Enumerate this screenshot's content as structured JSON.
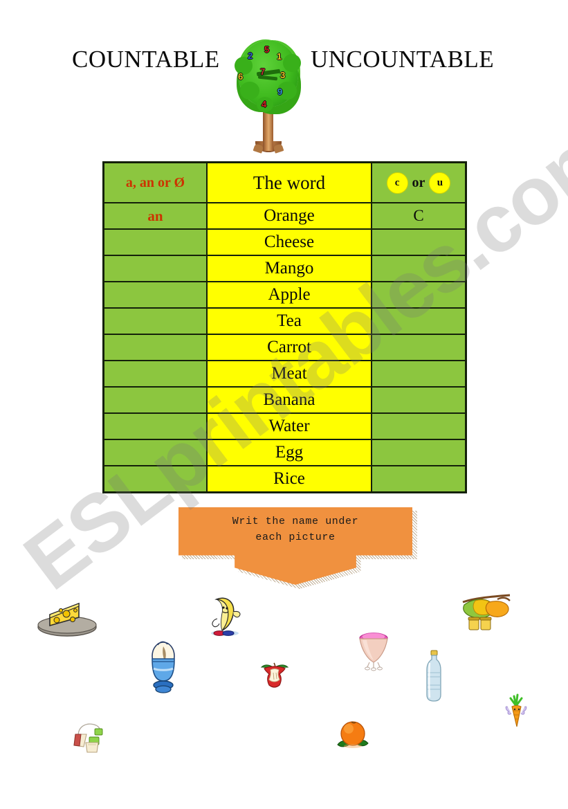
{
  "document": {
    "title_left": "COUNTABLE",
    "title_right": "UNCOUNTABLE",
    "watermark": "ESLprintables.com"
  },
  "tree": {
    "name": "number-tree",
    "numbers": [
      "2",
      "5",
      "1",
      "7",
      "6",
      "3",
      "9",
      "4"
    ]
  },
  "table": {
    "headers": {
      "article": "a, an or Ø",
      "word": "The word",
      "countable_circle": "c",
      "or_label": "or",
      "uncountable_circle": "u"
    },
    "rows": [
      {
        "article": "an",
        "word": "Orange",
        "cu": "C"
      },
      {
        "article": "",
        "word": "Cheese",
        "cu": ""
      },
      {
        "article": "",
        "word": "Mango",
        "cu": ""
      },
      {
        "article": "",
        "word": "Apple",
        "cu": ""
      },
      {
        "article": "",
        "word": "Tea",
        "cu": ""
      },
      {
        "article": "",
        "word": "Carrot",
        "cu": ""
      },
      {
        "article": "",
        "word": "Meat",
        "cu": ""
      },
      {
        "article": "",
        "word": "Banana",
        "cu": ""
      },
      {
        "article": "",
        "word": "Water",
        "cu": ""
      },
      {
        "article": "",
        "word": "Egg",
        "cu": ""
      },
      {
        "article": "",
        "word": "Rice",
        "cu": ""
      }
    ]
  },
  "instruction": {
    "line1": "Writ the name under",
    "line2": "each picture"
  },
  "pictures": [
    {
      "name": "cheese-on-plate-picture",
      "label": "cheese"
    },
    {
      "name": "banana-character-picture",
      "label": "banana"
    },
    {
      "name": "mangoes-on-branch-picture",
      "label": "mango"
    },
    {
      "name": "ice-cream-cup-picture",
      "label": "ice cream"
    },
    {
      "name": "egg-in-cup-picture",
      "label": "egg"
    },
    {
      "name": "apple-core-picture",
      "label": "apple"
    },
    {
      "name": "water-bottle-picture",
      "label": "water"
    },
    {
      "name": "carrot-picture",
      "label": "carrot"
    },
    {
      "name": "tea-bags-picture",
      "label": "tea"
    },
    {
      "name": "orange-fruit-picture",
      "label": "orange"
    }
  ],
  "colors": {
    "green_cell": "#8cc63f",
    "yellow_cell": "#ffff00",
    "red_text": "#cc3300",
    "orange_banner": "#f0913f",
    "border": "#14210a"
  }
}
